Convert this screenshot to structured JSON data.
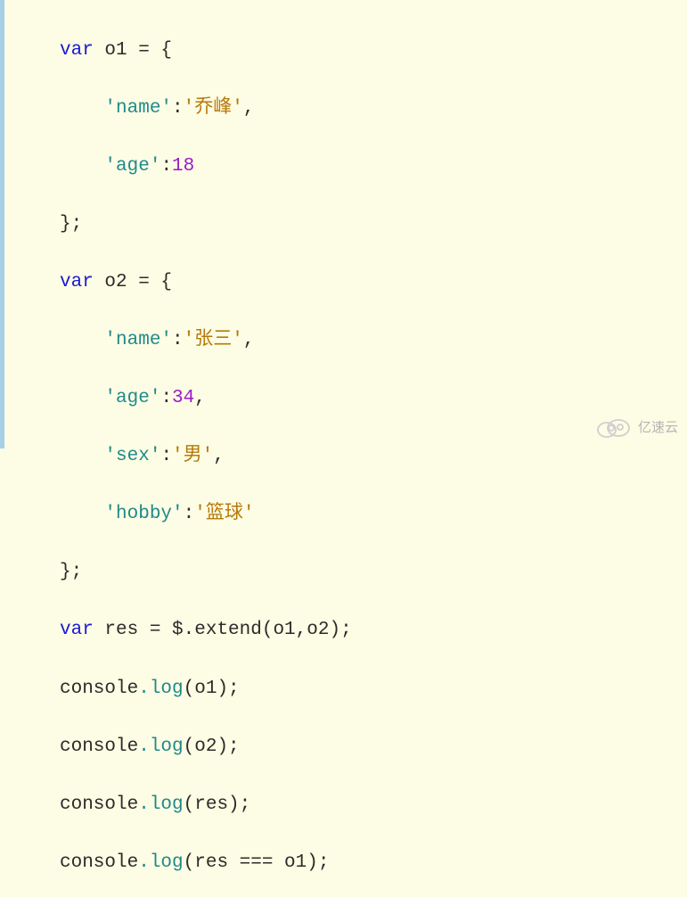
{
  "code": {
    "kw_var": "var",
    "o1": {
      "decl": "o1 = {",
      "name_key": "'name'",
      "name_val": "'乔峰'",
      "age_key": "'age'",
      "age_val": "18"
    },
    "o2": {
      "decl": "o2 = {",
      "name_key": "'name'",
      "name_val": "'张三'",
      "age_key": "'age'",
      "age_val": "34",
      "sex_key": "'sex'",
      "sex_val": "'男'",
      "hobby_key": "'hobby'",
      "hobby_val": "'篮球'"
    },
    "close_brace": "};",
    "res_decl": "res = $.extend(o1,o2);",
    "log1": "console.log(o1);",
    "log2": "console.log(o2);",
    "log3": "console.log(res);",
    "log4": "console.log(res === o1);",
    "console_token": "console",
    "log_token": ".log",
    "comma": ",",
    "colon": ":"
  },
  "watermark": {
    "text": "亿速云"
  }
}
